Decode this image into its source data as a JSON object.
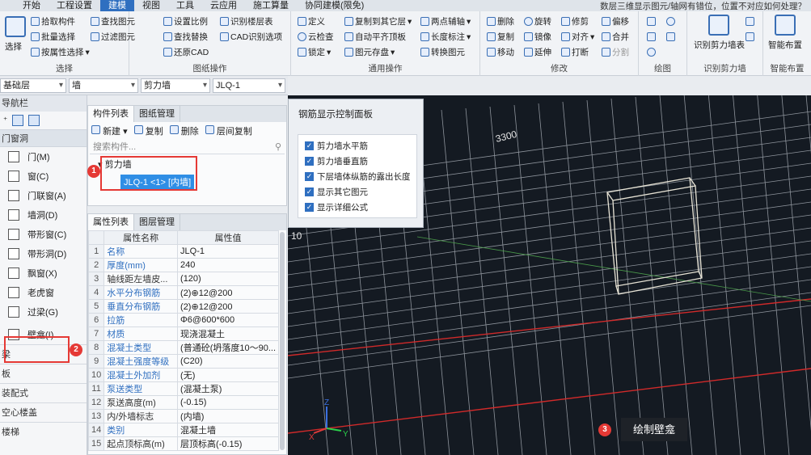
{
  "menu": {
    "items": [
      "开始",
      "工程设置",
      "建模",
      "视图",
      "工具",
      "云应用",
      "施工算量",
      "协同建模(限免)"
    ],
    "active_index": 2,
    "hint": "数层三维显示图元/轴网有错位，位置不对应如何处理？"
  },
  "ribbon": {
    "select": {
      "big": "选择",
      "items": [
        "拾取构件",
        "批量选择",
        "按属性选择"
      ],
      "col2": [
        "查找图元",
        "过滤图元"
      ],
      "title": "选择"
    },
    "drawing_ops": {
      "col1": [
        "设置比例",
        "查找替换",
        "还原CAD"
      ],
      "col2": [
        "识别楼层表",
        "CAD识别选项"
      ],
      "title": "图纸操作"
    },
    "general_ops": {
      "col1": [
        "定义",
        "云检查",
        "锁定"
      ],
      "col2": [
        "复制到其它层",
        "自动平齐顶板",
        "图元存盘"
      ],
      "col3": [
        "两点辅轴",
        "长度标注",
        "转换图元"
      ],
      "title": "通用操作"
    },
    "modify": {
      "col1": [
        "删除",
        "复制",
        "移动"
      ],
      "col2": [
        "旋转",
        "镜像",
        "延伸"
      ],
      "col3": [
        "修剪",
        "对齐",
        "打断"
      ],
      "col4": [
        "偏移",
        "合并",
        "分割"
      ],
      "title": "修改"
    },
    "draw": {
      "title": "绘图"
    },
    "recognize": {
      "big": "识别剪力墙表",
      "title": "识别剪力墙"
    },
    "smart": {
      "big": "智能布置",
      "title": "智能布置"
    }
  },
  "selectors": [
    "基础层",
    "墙",
    "剪力墙",
    "JLQ-1"
  ],
  "nav": {
    "title": "导航栏",
    "category": "门窗洞",
    "items": [
      "门(M)",
      "窗(C)",
      "门联窗(A)",
      "墙洞(D)",
      "带形窗(C)",
      "带形洞(D)",
      "飘窗(X)",
      "老虎窗",
      "过梁(G)",
      "壁龛(I)"
    ],
    "sections": [
      "梁",
      "板",
      "装配式",
      "空心楼盖",
      "楼梯"
    ]
  },
  "component_list": {
    "tabs": [
      "构件列表",
      "图纸管理"
    ],
    "tools": [
      "新建",
      "复制",
      "删除",
      "层间复制"
    ],
    "search_placeholder": "搜索构件...",
    "tree_root": "剪力墙",
    "tree_node": "JLQ-1 <1> [内墙]"
  },
  "property_list": {
    "tabs": [
      "属性列表",
      "图层管理"
    ],
    "headers": [
      "属性名称",
      "属性值"
    ],
    "rows": [
      {
        "n": "1",
        "k": "名称",
        "v": "JLQ-1",
        "blue": true
      },
      {
        "n": "2",
        "k": "厚度(mm)",
        "v": "240",
        "blue": true
      },
      {
        "n": "3",
        "k": "轴线距左墙皮...",
        "v": "(120)",
        "blue": false
      },
      {
        "n": "4",
        "k": "水平分布钢筋",
        "v": "(2)⊕12@200",
        "blue": true
      },
      {
        "n": "5",
        "k": "垂直分布钢筋",
        "v": "(2)⊕12@200",
        "blue": true
      },
      {
        "n": "6",
        "k": "拉筋",
        "v": "Φ6@600*600",
        "blue": true
      },
      {
        "n": "7",
        "k": "材质",
        "v": "现浇混凝土",
        "blue": true
      },
      {
        "n": "8",
        "k": "混凝土类型",
        "v": "(普通砼(坍落度10～90...",
        "blue": true
      },
      {
        "n": "9",
        "k": "混凝土强度等级",
        "v": "(C20)",
        "blue": true
      },
      {
        "n": "10",
        "k": "混凝土外加剂",
        "v": "(无)",
        "blue": true
      },
      {
        "n": "11",
        "k": "泵送类型",
        "v": "(混凝土泵)",
        "blue": true
      },
      {
        "n": "12",
        "k": "泵送高度(m)",
        "v": "(-0.15)",
        "blue": false
      },
      {
        "n": "13",
        "k": "内/外墙标志",
        "v": "(内墙)",
        "blue": false
      },
      {
        "n": "14",
        "k": "类别",
        "v": "混凝土墙",
        "blue": true
      },
      {
        "n": "15",
        "k": "起点顶标高(m)",
        "v": "层顶标高(-0.15)",
        "blue": false
      }
    ]
  },
  "viewport": {
    "dim_label": "3300",
    "side_label": "10",
    "axes": [
      "Z",
      "X",
      "Y"
    ]
  },
  "rebar_panel": {
    "title": "钢筋显示控制面板",
    "options": [
      "剪力墙水平筋",
      "剪力墙垂直筋",
      "下层墙体纵筋的露出长度",
      "显示其它图元",
      "显示详细公式"
    ]
  },
  "annotations": {
    "badges": [
      "1",
      "2",
      "3"
    ],
    "draw_label": "绘制壁龛"
  },
  "colors": {
    "accent": "#2f6fc0",
    "highlight_red": "#e53935",
    "viewport_bg": "#141a22"
  }
}
